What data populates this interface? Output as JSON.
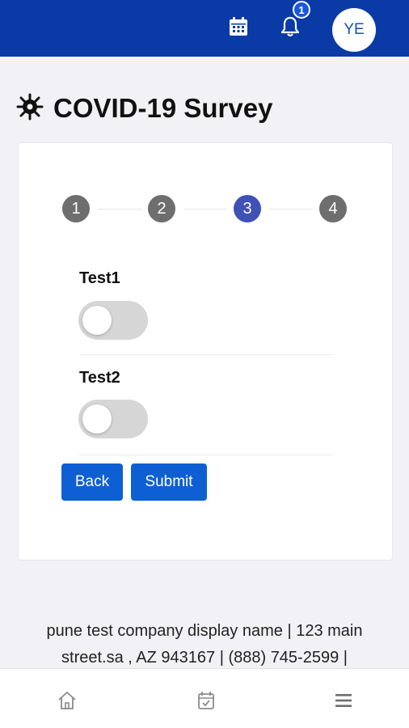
{
  "header": {
    "notification_count": "1",
    "avatar_initials": "YE",
    "icons": [
      "calendar-icon",
      "bell-icon"
    ],
    "color": "#0a3aa6"
  },
  "page": {
    "title": "COVID-19 Survey",
    "title_icon": "virus-icon"
  },
  "stepper": {
    "steps": [
      "1",
      "2",
      "3",
      "4"
    ],
    "active_step": 3,
    "active_color": "#3f51b5",
    "inactive_color": "#6e6e6e"
  },
  "questions": [
    {
      "label": "Test1",
      "value": false
    },
    {
      "label": "Test2",
      "value": false
    }
  ],
  "buttons": {
    "back": "Back",
    "submit": "Submit",
    "color": "#0f5fd4"
  },
  "footer": {
    "line1": "pune test company display name | 123 main",
    "line2": "street.sa , AZ 943167 | (888) 745-2599 |"
  },
  "bottom_nav": {
    "icons": [
      "home-icon",
      "task-calendar-icon",
      "menu-icon"
    ]
  }
}
